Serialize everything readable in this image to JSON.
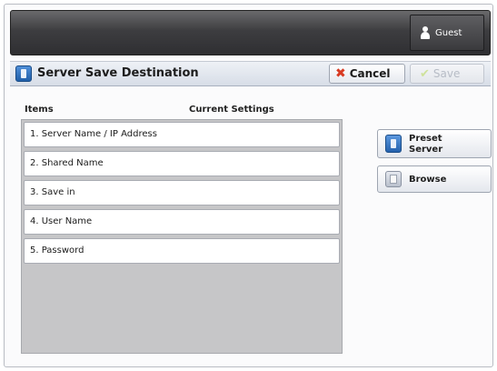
{
  "header": {
    "user_label": "Guest"
  },
  "title": {
    "text": "Server Save Destination"
  },
  "toolbar": {
    "cancel_label": "Cancel",
    "save_label": "Save"
  },
  "columns": {
    "items": "Items",
    "current_settings": "Current Settings"
  },
  "rows": [
    {
      "label": "1. Server Name / IP Address",
      "value": ""
    },
    {
      "label": "2. Shared Name",
      "value": ""
    },
    {
      "label": "3. Save in",
      "value": ""
    },
    {
      "label": "4. User Name",
      "value": ""
    },
    {
      "label": "5. Password",
      "value": ""
    }
  ],
  "side_buttons": {
    "preset_server_line1": "Preset",
    "preset_server_line2": "Server",
    "browse_label": "Browse"
  },
  "icons": [
    "user-icon",
    "server-destination-icon",
    "cancel-x-icon",
    "save-check-icon",
    "preset-server-icon",
    "browse-icon"
  ],
  "colors": {
    "cancel_accent": "#d83a22",
    "save_disabled": "#b7bcc6"
  }
}
